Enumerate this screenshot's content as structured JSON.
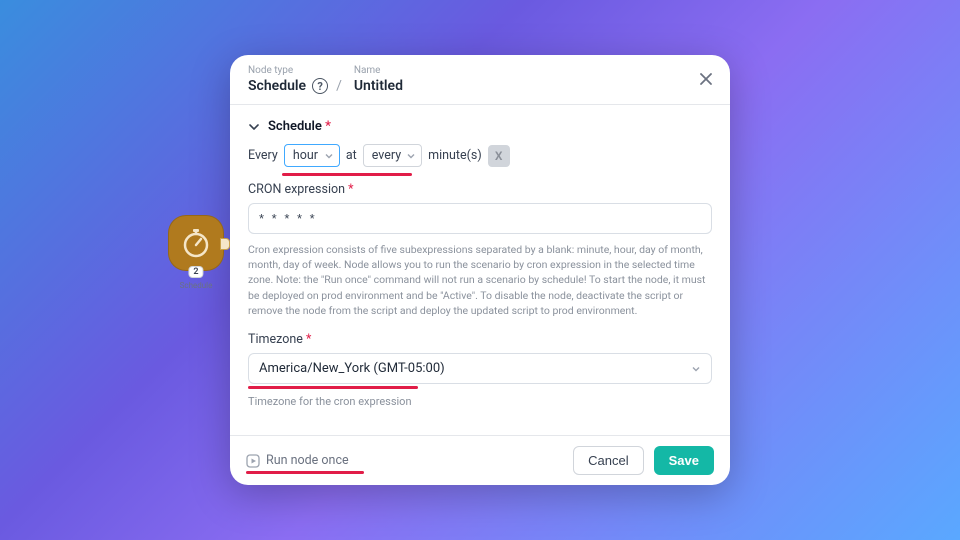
{
  "header": {
    "node_type_label": "Node type",
    "node_type_value": "Schedule",
    "name_label": "Name",
    "name_value": "Untitled"
  },
  "section": {
    "title": "Schedule"
  },
  "interval": {
    "prefix": "Every",
    "unit_value": "hour",
    "at": "at",
    "minute_value": "every",
    "suffix": "minute(s)",
    "x": "X"
  },
  "cron": {
    "label": "CRON expression",
    "value": "* * * * *",
    "help": "Cron expression consists of five subexpressions separated by a blank: minute, hour, day of month, month, day of week. Node allows you to run the scenario by cron expression in the selected time zone. Note: the \"Run once\" command will not run a scenario by schedule! To start the node, it must be deployed on prod environment and be \"Active\". To disable the node, deactivate the script or remove the node from the script and deploy the updated script to prod environment."
  },
  "timezone": {
    "label": "Timezone",
    "value": "America/New_York (GMT-05:00)",
    "help": "Timezone for the cron expression"
  },
  "footer": {
    "run_once": "Run node once",
    "cancel": "Cancel",
    "save": "Save"
  },
  "node": {
    "badge": "2",
    "label": "Schedule"
  }
}
